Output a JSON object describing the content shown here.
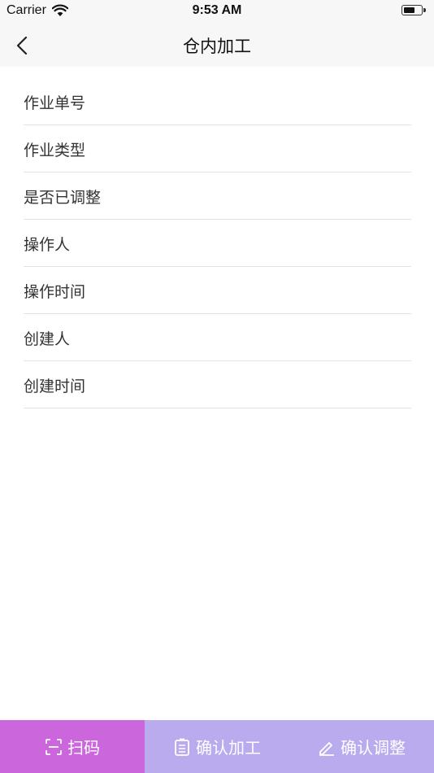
{
  "status_bar": {
    "carrier": "Carrier",
    "time": "9:53 AM"
  },
  "nav": {
    "title": "仓内加工",
    "back_icon": "chevron-left-icon"
  },
  "form": {
    "rows": [
      {
        "label": "作业单号"
      },
      {
        "label": "作业类型"
      },
      {
        "label": "是否已调整"
      },
      {
        "label": "操作人"
      },
      {
        "label": "操作时间"
      },
      {
        "label": "创建人"
      },
      {
        "label": "创建时间"
      }
    ]
  },
  "actions": {
    "scan": {
      "label": "扫码",
      "icon": "scan-icon",
      "color": "#cb66dc"
    },
    "confirm_process": {
      "label": "确认加工",
      "icon": "clipboard-icon",
      "color": "#b9abee"
    },
    "confirm_adjust": {
      "label": "确认调整",
      "icon": "pencil-icon",
      "color": "#b9abee"
    }
  }
}
